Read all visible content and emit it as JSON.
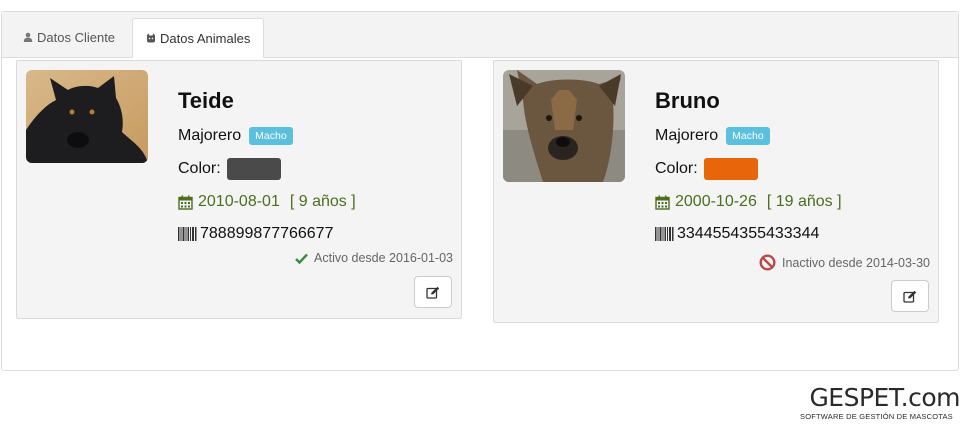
{
  "tabs": [
    {
      "label": "Datos Cliente",
      "icon": "user-icon",
      "active": false
    },
    {
      "label": "Datos Animales",
      "icon": "paw-icon",
      "active": true
    }
  ],
  "animals": [
    {
      "name": "Teide",
      "breed": "Majorero",
      "sex": "Macho",
      "color_label": "Color:",
      "color_value": "#4a4a4a",
      "birth_date": "2010-08-01",
      "age": "[ 9 años ]",
      "chip": "788899877766677",
      "status": "Activo desde 2016-01-03",
      "status_icon": "check-icon",
      "status_color": "#3c8a3c"
    },
    {
      "name": "Bruno",
      "breed": "Majorero",
      "sex": "Macho",
      "color_label": "Color:",
      "color_value": "#e8650a",
      "birth_date": "2000-10-26",
      "age": "[ 19 años ]",
      "chip": "3344554355433344",
      "status": "Inactivo desde 2014-03-30",
      "status_icon": "ban-icon",
      "status_color": "#b94a48"
    }
  ],
  "colors": {
    "badge": "#5bc0de",
    "date_text": "#4c6e1e"
  },
  "logo": {
    "main": "GESPET.com",
    "sub": "Software de gestión de mascotas"
  }
}
